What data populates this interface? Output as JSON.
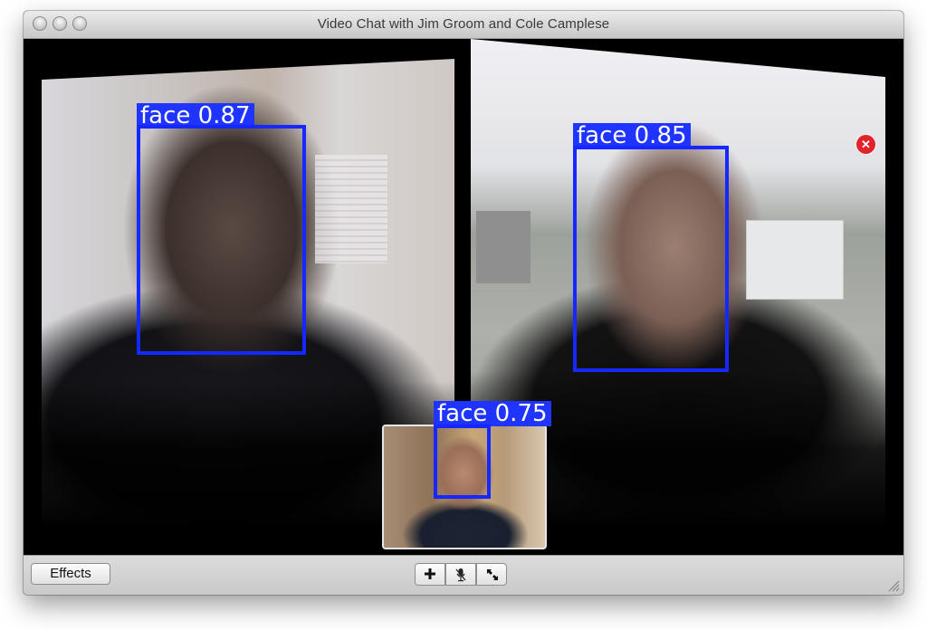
{
  "window": {
    "title": "Video Chat with Jim Groom and Cole Camplese"
  },
  "detections": [
    {
      "label": "face 0.87",
      "color": "#1428ff"
    },
    {
      "label": "face 0.85",
      "color": "#1428ff"
    },
    {
      "label": "face 0.75",
      "color": "#1428ff"
    }
  ],
  "toolbar": {
    "effects_label": "Effects",
    "buttons": [
      {
        "icon": "plus-icon"
      },
      {
        "icon": "microphone-mute-icon"
      },
      {
        "icon": "fullscreen-icon"
      }
    ]
  },
  "icons": {
    "close": "close-icon"
  }
}
